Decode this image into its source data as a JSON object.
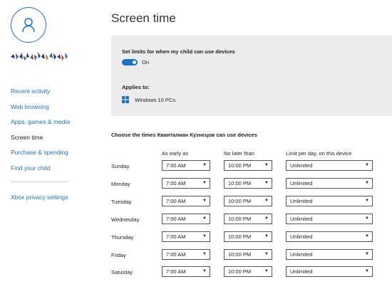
{
  "sidebar": {
    "nav": [
      {
        "label": "Recent activity",
        "active": false
      },
      {
        "label": "Web browsing",
        "active": false
      },
      {
        "label": "Apps, games & media",
        "active": false
      },
      {
        "label": "Screen time",
        "active": true
      },
      {
        "label": "Purchase & spending",
        "active": false
      },
      {
        "label": "Find your child",
        "active": false
      }
    ],
    "xbox_link": "Xbox privacy settings"
  },
  "main": {
    "title": "Screen time",
    "limits_label": "Set limits for when my child can use devices",
    "toggle_state": "On",
    "applies_to_label": "Applies to:",
    "device": "Windows 10 PCs",
    "schedule_heading": "Choose the times Кванталиан Кузнецов can use devices",
    "columns": [
      "As early as",
      "No later than",
      "Limit per day, on this device"
    ],
    "rows": [
      {
        "day": "Sunday",
        "early": "7:00 AM",
        "late": "10:00 PM",
        "limit": "Unlimited"
      },
      {
        "day": "Monday",
        "early": "7:00 AM",
        "late": "10:00 PM",
        "limit": "Unlimited"
      },
      {
        "day": "Tuesday",
        "early": "7:00 AM",
        "late": "10:00 PM",
        "limit": "Unlimited"
      },
      {
        "day": "Wednesday",
        "early": "7:00 AM",
        "late": "10:00 PM",
        "limit": "Unlimited"
      },
      {
        "day": "Thursday",
        "early": "7:00 AM",
        "late": "10:00 PM",
        "limit": "Unlimited"
      },
      {
        "day": "Friday",
        "early": "7:00 AM",
        "late": "10:00 PM",
        "limit": "Unlimited"
      },
      {
        "day": "Saturday",
        "early": "7:00 AM",
        "late": "10:00 PM",
        "limit": "Unlimited"
      }
    ]
  },
  "icons": {
    "avatar": "user-icon",
    "device": "windows-logo-icon",
    "dropdown": "chevron-down-icon"
  },
  "colors": {
    "accent": "#1a73c9",
    "panel_bg": "#ececec"
  }
}
